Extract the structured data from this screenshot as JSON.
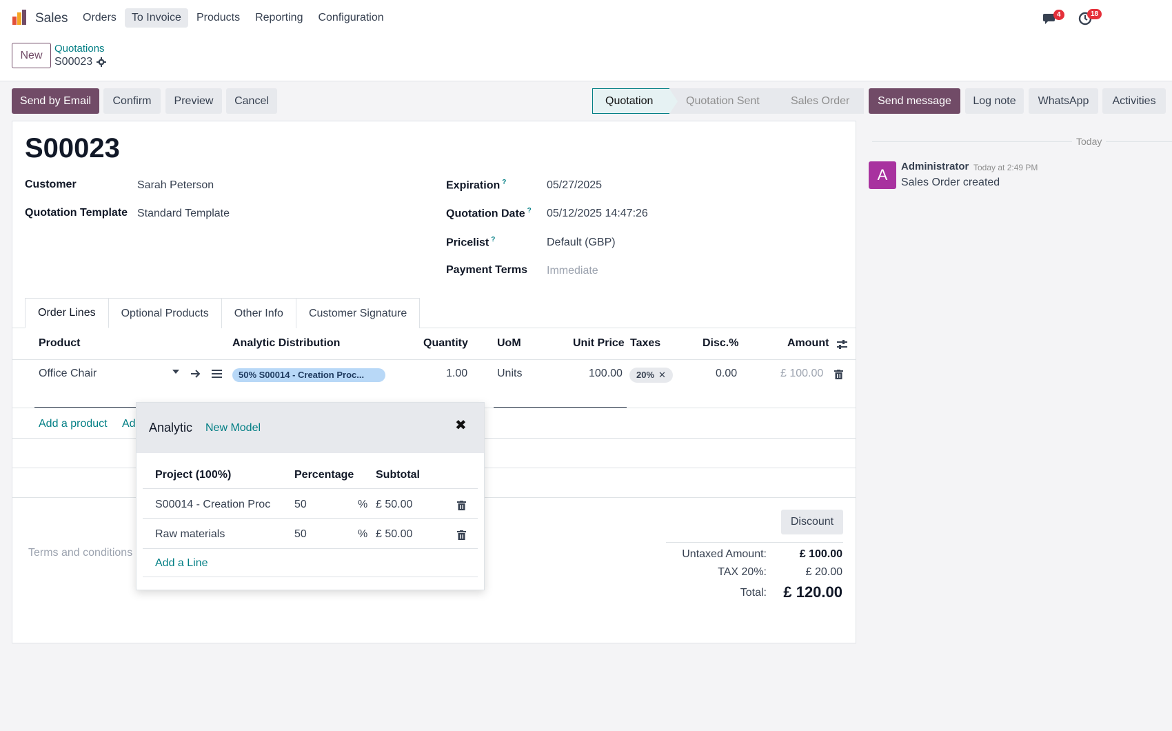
{
  "app": {
    "name": "Sales",
    "nav": [
      "Orders",
      "To Invoice",
      "Products",
      "Reporting",
      "Configuration"
    ],
    "messages_badge": "4",
    "activities_badge": "18"
  },
  "control": {
    "new_label": "New",
    "breadcrumb": "Quotations",
    "record": "S00023"
  },
  "actions": {
    "send_email": "Send by Email",
    "confirm": "Confirm",
    "preview": "Preview",
    "cancel": "Cancel"
  },
  "status": [
    "Quotation",
    "Quotation Sent",
    "Sales Order"
  ],
  "form": {
    "title": "S00023",
    "customer_label": "Customer",
    "customer": "Sarah Peterson",
    "template_label": "Quotation Template",
    "template": "Standard Template",
    "expiration_label": "Expiration",
    "expiration": "05/27/2025",
    "quotation_date_label": "Quotation Date",
    "quotation_date": "05/12/2025 14:47:26",
    "pricelist_label": "Pricelist",
    "pricelist": "Default (GBP)",
    "payment_terms_label": "Payment Terms",
    "payment_terms": "Immediate",
    "help_mark": "?"
  },
  "tabs": [
    "Order Lines",
    "Optional Products",
    "Other Info",
    "Customer Signature"
  ],
  "lines": {
    "headers": {
      "product": "Product",
      "analytic": "Analytic Distribution",
      "quantity": "Quantity",
      "uom": "UoM",
      "unit_price": "Unit Price",
      "taxes": "Taxes",
      "discount": "Disc.%",
      "amount": "Amount"
    },
    "row": {
      "product": "Office Chair",
      "analytic": "50% S00014 - Creation Proc...",
      "quantity": "1.00",
      "uom": "Units",
      "unit_price": "100.00",
      "tax": "20%",
      "discount": "0.00",
      "amount": "£ 100.00"
    },
    "add_product": "Add a product",
    "add_section_truncated": "Ad"
  },
  "popup": {
    "title": "Analytic",
    "new_model": "New Model",
    "headers": {
      "project": "Project (100%)",
      "percentage": "Percentage",
      "subtotal": "Subtotal"
    },
    "rows": [
      {
        "account": "S00014 - Creation Proc",
        "percentage": "50",
        "unit": "%",
        "subtotal": "£ 50.00"
      },
      {
        "account": "Raw materials",
        "percentage": "50",
        "unit": "%",
        "subtotal": "£ 50.00"
      }
    ],
    "add_line": "Add a Line"
  },
  "totals": {
    "discount_btn": "Discount",
    "untaxed_label": "Untaxed Amount:",
    "untaxed": "£ 100.00",
    "tax_label": "TAX 20%:",
    "tax": "£ 20.00",
    "total_label": "Total:",
    "total": "£ 120.00"
  },
  "terms_placeholder": "Terms and conditions",
  "chatter": {
    "send_message": "Send message",
    "log_note": "Log note",
    "whatsapp": "WhatsApp",
    "activities": "Activities",
    "today": "Today",
    "avatar_letter": "A",
    "author": "Administrator",
    "time": "Today at 2:49 PM",
    "body": "Sales Order created"
  },
  "colors": {
    "brand": "#714b67",
    "link": "#017e84",
    "badge": "#e5303a",
    "analytic_tag": "#b8d8f7",
    "avatar": "#a8329f"
  }
}
